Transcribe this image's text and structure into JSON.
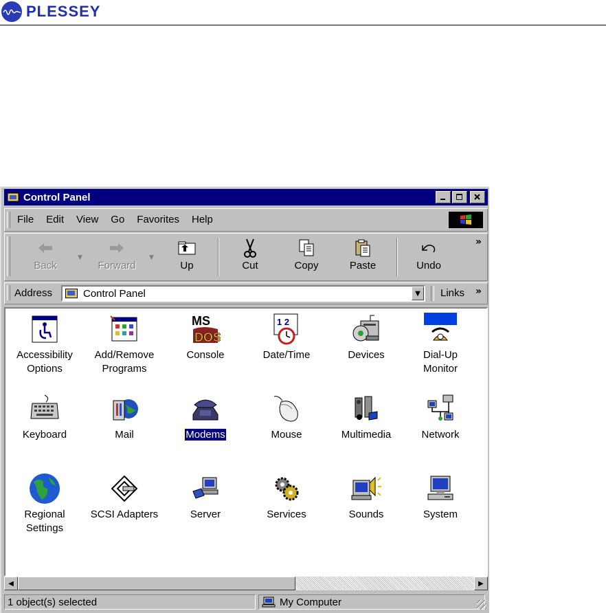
{
  "brand": {
    "name": "PLESSEY"
  },
  "window": {
    "title": "Control Panel",
    "controls": {
      "minimize": "_",
      "maximize": "□",
      "close": "✕"
    }
  },
  "menubar": {
    "items": [
      "File",
      "Edit",
      "View",
      "Go",
      "Favorites",
      "Help"
    ]
  },
  "toolbar": {
    "back": "Back",
    "forward": "Forward",
    "up": "Up",
    "cut": "Cut",
    "copy": "Copy",
    "paste": "Paste",
    "undo": "Undo",
    "more": "»"
  },
  "address": {
    "label": "Address",
    "value": "Control Panel",
    "links": "Links",
    "links_more": "»"
  },
  "icons": [
    {
      "name": "accessibility",
      "label1": "Accessibility",
      "label2": "Options"
    },
    {
      "name": "addremove",
      "label1": "Add/Remove",
      "label2": "Programs"
    },
    {
      "name": "console",
      "label1": "Console",
      "label2": ""
    },
    {
      "name": "datetime",
      "label1": "Date/Time",
      "label2": ""
    },
    {
      "name": "devices",
      "label1": "Devices",
      "label2": ""
    },
    {
      "name": "dialup",
      "label1": "Dial-Up",
      "label2": "Monitor"
    },
    {
      "name": "keyboard",
      "label1": "Keyboard",
      "label2": ""
    },
    {
      "name": "mail",
      "label1": "Mail",
      "label2": ""
    },
    {
      "name": "modems",
      "label1": "Modems",
      "label2": "",
      "selected": true
    },
    {
      "name": "mouse",
      "label1": "Mouse",
      "label2": ""
    },
    {
      "name": "multimedia",
      "label1": "Multimedia",
      "label2": ""
    },
    {
      "name": "network",
      "label1": "Network",
      "label2": ""
    },
    {
      "name": "regional",
      "label1": "Regional",
      "label2": "Settings"
    },
    {
      "name": "scsi",
      "label1": "SCSI Adapters",
      "label2": ""
    },
    {
      "name": "server",
      "label1": "Server",
      "label2": ""
    },
    {
      "name": "services",
      "label1": "Services",
      "label2": ""
    },
    {
      "name": "sounds",
      "label1": "Sounds",
      "label2": ""
    },
    {
      "name": "system",
      "label1": "System",
      "label2": ""
    }
  ],
  "status": {
    "left": "1 object(s) selected",
    "right": "My Computer"
  },
  "colors": {
    "titlebar": "#000080",
    "face": "#c0c0c0",
    "selection": "#000080"
  }
}
